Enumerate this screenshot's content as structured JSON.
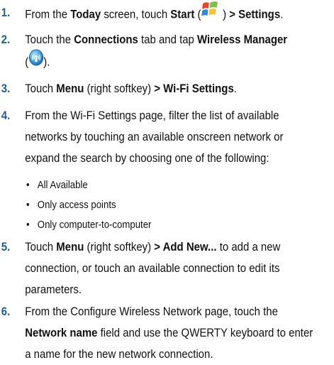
{
  "steps": [
    {
      "number": "1.",
      "lines": [
        {
          "parts": [
            {
              "text": "From the ",
              "bold": false
            },
            {
              "text": "Today",
              "bold": true
            },
            {
              "text": " screen, touch ",
              "bold": false
            },
            {
              "text": "Start",
              "bold": true
            },
            {
              "text": " (",
              "bold": false
            },
            {
              "icon": "windows-start-icon"
            },
            {
              "text": " ) ",
              "bold": false
            },
            {
              "text": "> Settings",
              "bold": true
            },
            {
              "text": ".",
              "bold": false
            }
          ]
        }
      ]
    },
    {
      "number": "2.",
      "lines": [
        {
          "parts": [
            {
              "text": "Touch the ",
              "bold": false
            },
            {
              "text": "Connections",
              "bold": true
            },
            {
              "text": " tab and tap ",
              "bold": false
            },
            {
              "text": "Wireless Manager",
              "bold": true
            }
          ]
        },
        {
          "parts": [
            {
              "text": "(",
              "bold": false
            },
            {
              "icon": "wireless-manager-icon"
            },
            {
              "text": ").",
              "bold": false
            }
          ]
        }
      ]
    },
    {
      "number": "3.",
      "lines": [
        {
          "parts": [
            {
              "text": "Touch ",
              "bold": false
            },
            {
              "text": "Menu",
              "bold": true
            },
            {
              "text": " (right softkey) ",
              "bold": false
            },
            {
              "text": "> Wi-Fi Settings",
              "bold": true
            },
            {
              "text": ".",
              "bold": false
            }
          ]
        }
      ]
    },
    {
      "number": "4.",
      "lines": [
        {
          "parts": [
            {
              "text": "From the Wi-Fi Settings page, filter the list of available",
              "bold": false
            }
          ]
        },
        {
          "parts": [
            {
              "text": "networks by touching an available onscreen network or",
              "bold": false
            }
          ]
        },
        {
          "parts": [
            {
              "text": "expand the search by choosing one of the following:",
              "bold": false
            }
          ]
        }
      ]
    },
    {
      "number": "5.",
      "lines": [
        {
          "parts": [
            {
              "text": "Touch ",
              "bold": false
            },
            {
              "text": "Menu",
              "bold": true
            },
            {
              "text": " (right softkey) ",
              "bold": false
            },
            {
              "text": "> Add New...",
              "bold": true
            },
            {
              "text": " to add a new",
              "bold": false
            }
          ]
        },
        {
          "parts": [
            {
              "text": "connection, or touch an available connection to edit its",
              "bold": false
            }
          ]
        },
        {
          "parts": [
            {
              "text": "parameters.",
              "bold": false
            }
          ]
        }
      ]
    },
    {
      "number": "6.",
      "lines": [
        {
          "parts": [
            {
              "text": "From the Configure Wireless Network page, touch the",
              "bold": false
            }
          ]
        },
        {
          "parts": [
            {
              "text": "Network name",
              "bold": true
            },
            {
              "text": " field and use the QWERTY keyboard to enter",
              "bold": false
            }
          ]
        },
        {
          "parts": [
            {
              "text": "a name for the new network connection.",
              "bold": false
            }
          ]
        }
      ]
    }
  ],
  "bullets": {
    "marker": "•",
    "items": [
      "All Available",
      "Only access points",
      "Only computer-to-computer"
    ]
  },
  "colors": {
    "step_number": "#1c5e96",
    "text": "#111111"
  }
}
